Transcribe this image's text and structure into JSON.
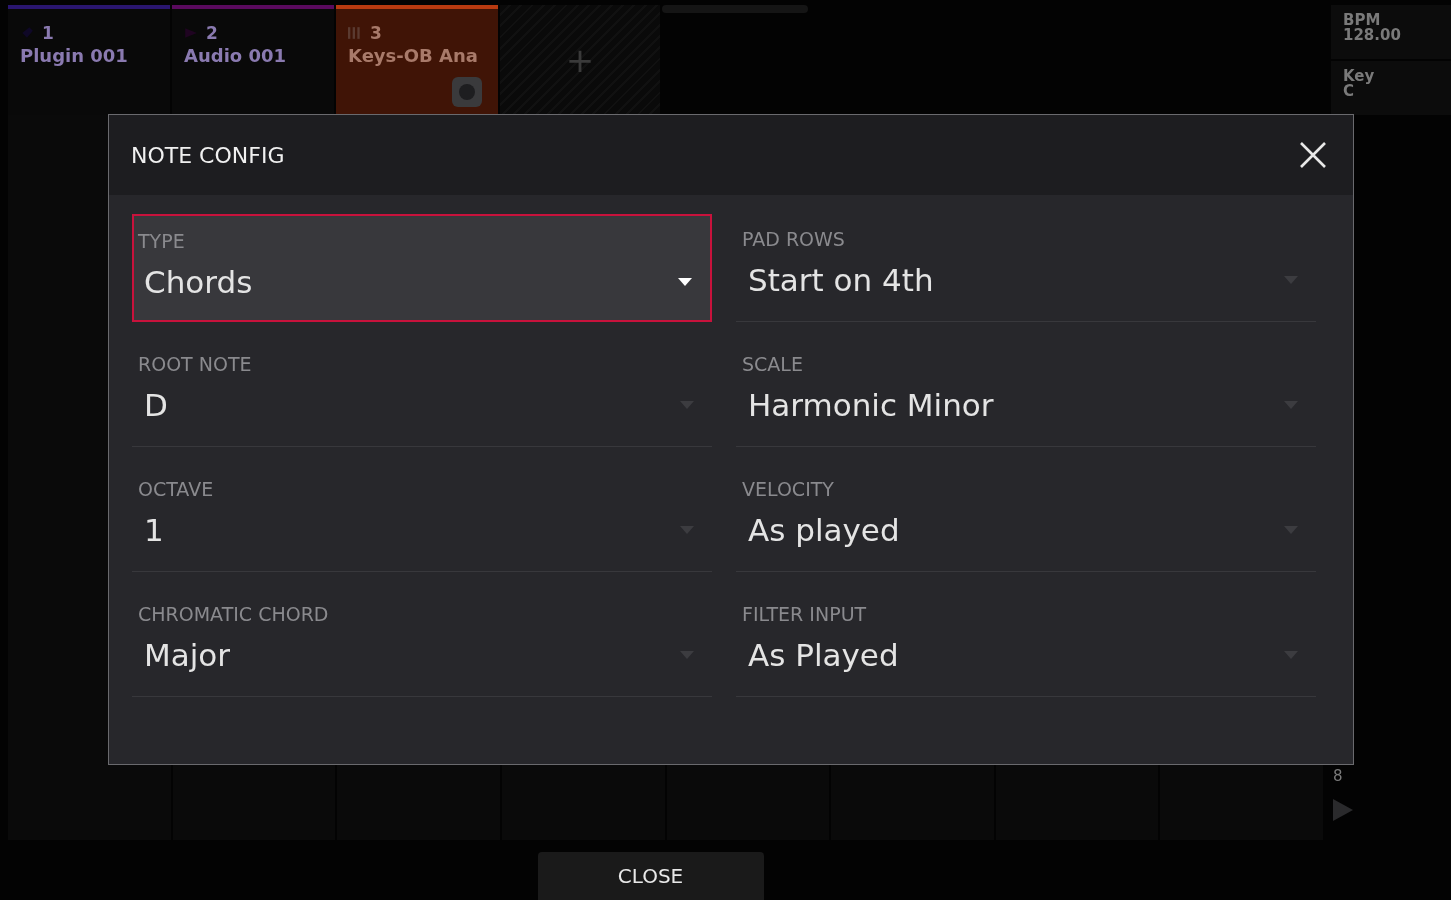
{
  "tracks": [
    {
      "number": "1",
      "name": "Plugin 001",
      "kind": "plugin",
      "color": "#2a1670",
      "selected": false
    },
    {
      "number": "2",
      "name": "Audio 001",
      "kind": "audio",
      "color": "#5a0a5e",
      "selected": false
    },
    {
      "number": "3",
      "name": "Keys-OB Ana",
      "kind": "keys",
      "color": "#b83a10",
      "selected": true
    }
  ],
  "add_track": "+",
  "info_panel": [
    {
      "label": "BPM",
      "value": "128.00"
    },
    {
      "label": "Key",
      "value": "C"
    }
  ],
  "side_number": "8",
  "dialog": {
    "title": "NOTE CONFIG",
    "fields": [
      {
        "label": "TYPE",
        "value": "Chords",
        "selected": true
      },
      {
        "label": "PAD ROWS",
        "value": "Start on 4th",
        "selected": false
      },
      {
        "label": "ROOT NOTE",
        "value": "D",
        "selected": false
      },
      {
        "label": "SCALE",
        "value": "Harmonic Minor",
        "selected": false
      },
      {
        "label": "OCTAVE",
        "value": "1",
        "selected": false
      },
      {
        "label": "VELOCITY",
        "value": "As played",
        "selected": false
      },
      {
        "label": "CHROMATIC CHORD",
        "value": "Major",
        "selected": false
      },
      {
        "label": "FILTER INPUT",
        "value": "As Played",
        "selected": false
      }
    ]
  },
  "close_button": "CLOSE"
}
